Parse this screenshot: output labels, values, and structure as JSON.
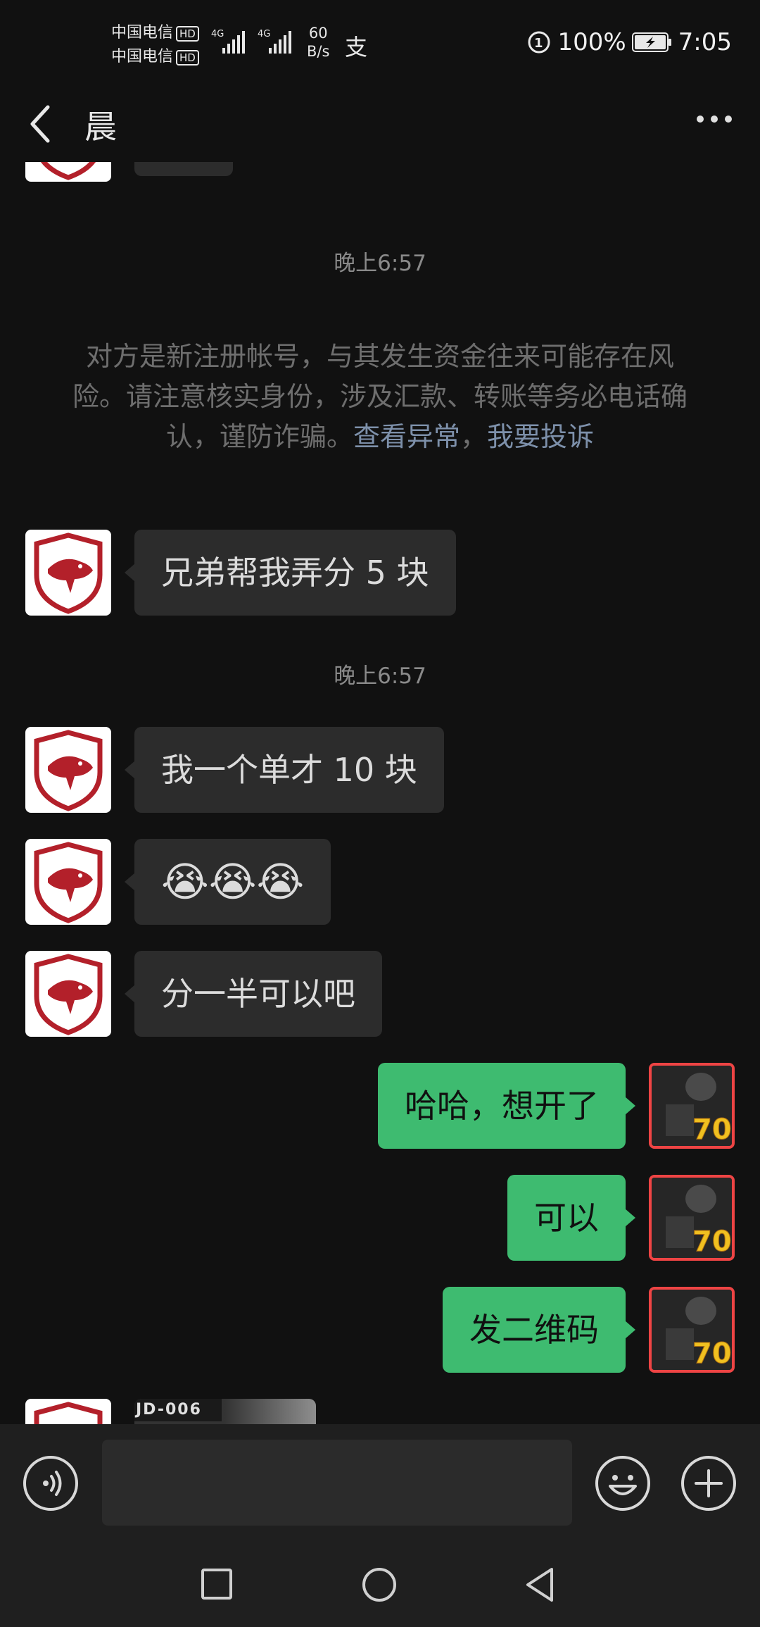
{
  "status_bar": {
    "carrier_1": "中国电信",
    "carrier_2": "中国电信",
    "hd": "HD",
    "network": "4G",
    "net_speed_value": "60",
    "net_speed_unit": "B/s",
    "alipay_glyph": "支",
    "battery_percent": "100%",
    "time": "7:05"
  },
  "header": {
    "title": "晨",
    "back_icon": "back-chevron-icon",
    "more_icon": "more-dots-icon"
  },
  "chat": {
    "timestamp_1": "晚上6:57",
    "system_notice": {
      "text": "对方是新注册帐号，与其发生资金往来可能存在风险。请注意核实身份，涉及汇款、转账等务必电话确认，谨防诈骗。",
      "link_1": "查看异常",
      "separator": "，",
      "link_2": "我要投诉"
    },
    "timestamp_2": "晚上6:57",
    "messages": [
      {
        "side": "in",
        "text": "兄弟帮我弄分 5 块"
      },
      {
        "side": "in",
        "text": "我一个单才 10 块"
      },
      {
        "side": "in",
        "text": "😭😭😭"
      },
      {
        "side": "in",
        "text": "分一半可以吧"
      },
      {
        "side": "out",
        "text": "哈哈，想开了"
      },
      {
        "side": "out",
        "text": "可以"
      },
      {
        "side": "out",
        "text": "发二维码"
      }
    ],
    "card_label": "JD-006"
  },
  "input_bar": {
    "voice_icon": "voice-input-icon",
    "emoji_icon": "emoji-icon",
    "plus_icon": "plus-icon",
    "input_value": ""
  },
  "navbar": {
    "recents_icon": "recents-square-icon",
    "home_icon": "home-circle-icon",
    "back_icon": "back-triangle-icon"
  },
  "colors": {
    "background": "#111111",
    "incoming_bubble": "#2c2c2c",
    "outgoing_bubble": "#3ebb70",
    "link": "#7d90aa",
    "avatar_red": "#b3202a"
  }
}
